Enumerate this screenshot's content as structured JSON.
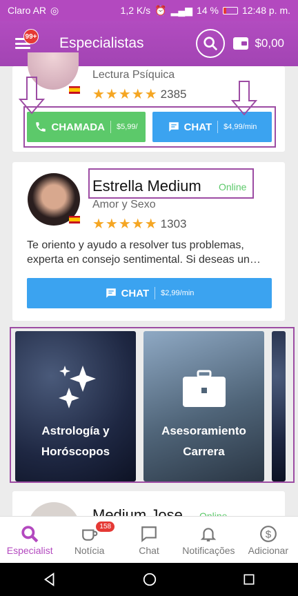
{
  "status": {
    "carrier": "Claro AR",
    "speed": "1,2 K/s",
    "battery": "14 %",
    "time": "12:48 p. m."
  },
  "appbar": {
    "badge": "99+",
    "title": "Especialistas",
    "balance": "$0,00"
  },
  "card1": {
    "category": "Lectura Psíquica",
    "rating": "2385",
    "call_label": "CHAMADA",
    "call_price": "$5,99/",
    "chat_label": "CHAT",
    "chat_price": "$4,99/min"
  },
  "card2": {
    "name": "Estrella Medium",
    "status": "Online",
    "category": "Amor y Sexo",
    "rating": "1303",
    "description": "Te oriento y ayudo a resolver tus problemas, experta en consejo sentimental. Si deseas un…",
    "chat_label": "CHAT",
    "chat_price": "$2,99/min"
  },
  "categories": [
    {
      "name": "Astrología y Horóscopos"
    },
    {
      "name": "Asesoramiento Carrera"
    }
  ],
  "card3": {
    "name": "Medium Jose",
    "status": "Online"
  },
  "nav": [
    {
      "label": "Especialist"
    },
    {
      "label": "Notícia",
      "badge": "158"
    },
    {
      "label": "Chat"
    },
    {
      "label": "Notificações"
    },
    {
      "label": "Adicionar"
    }
  ],
  "colors": {
    "accent": "#b349bf",
    "call": "#5cc96a",
    "chat": "#3ba3f0",
    "star": "#f5a623"
  }
}
